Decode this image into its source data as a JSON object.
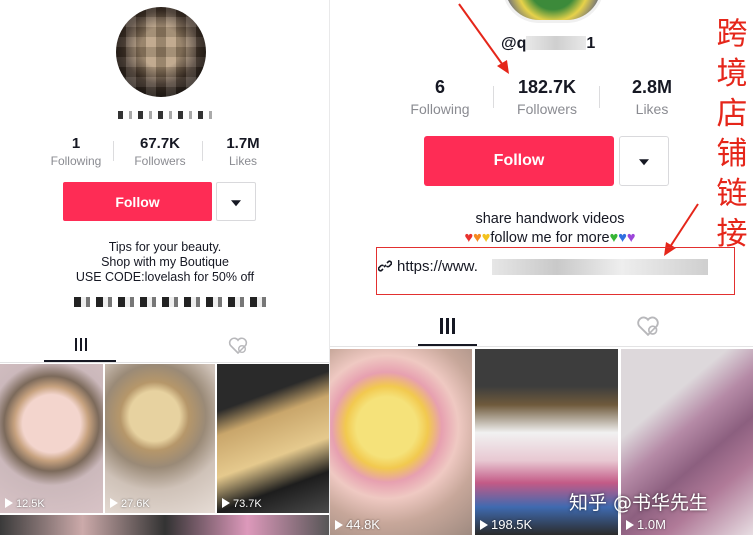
{
  "left": {
    "stats": [
      {
        "value": "1",
        "label": "Following"
      },
      {
        "value": "67.7K",
        "label": "Followers"
      },
      {
        "value": "1.7M",
        "label": "Likes"
      }
    ],
    "follow_label": "Follow",
    "bio": [
      "Tips for your beauty.",
      "Shop with my Boutique",
      "USE CODE:lovelash for 50% off"
    ],
    "videos": [
      {
        "views": "12.5K"
      },
      {
        "views": "27.6K"
      },
      {
        "views": "73.7K"
      }
    ]
  },
  "right": {
    "handle_prefix": "@q",
    "handle_suffix": "1",
    "stats": [
      {
        "value": "6",
        "label": "Following"
      },
      {
        "value": "182.7K",
        "label": "Followers"
      },
      {
        "value": "2.8M",
        "label": "Likes"
      }
    ],
    "follow_label": "Follow",
    "bio_line1": "share handwork videos",
    "bio_line2": "follow me for more",
    "link_text": "https://www.",
    "videos": [
      {
        "views": "44.8K"
      },
      {
        "views": "198.5K"
      },
      {
        "views": "1.0M"
      }
    ],
    "side_text": [
      "跨",
      "境",
      "店",
      "铺",
      "链",
      "接"
    ],
    "watermark": "知乎 @书华先生"
  },
  "colors": {
    "accent": "#fe2c55",
    "annotation": "#e5261a"
  }
}
